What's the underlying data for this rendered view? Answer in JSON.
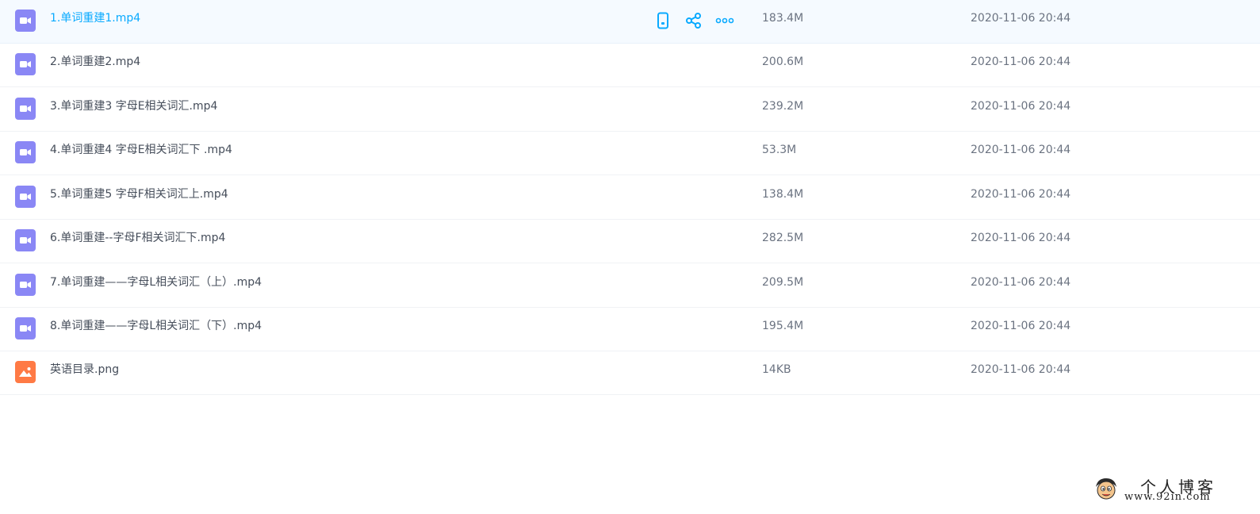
{
  "colors": {
    "video_icon": "#8a87f5",
    "image_icon": "#ff7a45",
    "accent": "#09aaff"
  },
  "files": [
    {
      "name": "1.单词重建1.mp4",
      "size": "183.4M",
      "date": "2020-11-06 20:44",
      "icon": "video-file-icon"
    },
    {
      "name": "2.单词重建2.mp4",
      "size": "200.6M",
      "date": "2020-11-06 20:44",
      "icon": "video-file-icon"
    },
    {
      "name": "3.单词重建3 字母E相关词汇.mp4",
      "size": "239.2M",
      "date": "2020-11-06 20:44",
      "icon": "video-file-icon"
    },
    {
      "name": "4.单词重建4 字母E相关词汇下 .mp4",
      "size": "53.3M",
      "date": "2020-11-06 20:44",
      "icon": "video-file-icon"
    },
    {
      "name": "5.单词重建5 字母F相关词汇上.mp4",
      "size": "138.4M",
      "date": "2020-11-06 20:44",
      "icon": "video-file-icon"
    },
    {
      "name": "6.单词重建--字母F相关词汇下.mp4",
      "size": "282.5M",
      "date": "2020-11-06 20:44",
      "icon": "video-file-icon"
    },
    {
      "name": "7.单词重建——字母L相关词汇（上）.mp4",
      "size": "209.5M",
      "date": "2020-11-06 20:44",
      "icon": "video-file-icon"
    },
    {
      "name": "8.单词重建——字母L相关词汇（下）.mp4",
      "size": "195.4M",
      "date": "2020-11-06 20:44",
      "icon": "video-file-icon"
    },
    {
      "name": "英语目录.png",
      "size": "14KB",
      "date": "2020-11-06 20:44",
      "icon": "image-file-icon"
    }
  ],
  "hover_actions": [
    {
      "icon": "phone-icon"
    },
    {
      "icon": "share-icon"
    },
    {
      "icon": "more-icon"
    }
  ],
  "watermark": {
    "title": "个人博客",
    "url": "www.92in.com"
  }
}
